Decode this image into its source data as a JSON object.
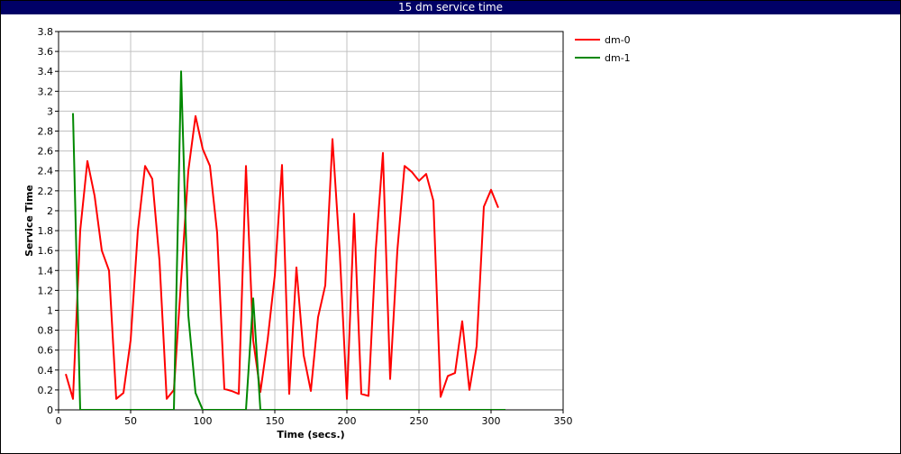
{
  "title": "15 dm service time",
  "colors": {
    "title_bar": "#000066",
    "title_text": "#ffffff",
    "grid": "#c0c0c0",
    "axis": "#000000"
  },
  "chart_data": {
    "type": "line",
    "title": "15 dm service time",
    "xlabel": "Time (secs.)",
    "ylabel": "Service Time",
    "xlim": [
      0,
      350
    ],
    "ylim": [
      0,
      3.8
    ],
    "xticks": [
      0,
      50,
      100,
      150,
      200,
      250,
      300,
      350
    ],
    "yticks": [
      0,
      0.2,
      0.4,
      0.6,
      0.8,
      1,
      1.2,
      1.4,
      1.6,
      1.8,
      2,
      2.2,
      2.4,
      2.6,
      2.8,
      3,
      3.2,
      3.4,
      3.6,
      3.8
    ],
    "grid": true,
    "legend_position": "right",
    "series": [
      {
        "name": "dm-0",
        "color": "#ff0000",
        "x": [
          5,
          10,
          15,
          20,
          25,
          30,
          35,
          40,
          45,
          50,
          55,
          60,
          65,
          70,
          75,
          80,
          85,
          90,
          95,
          100,
          105,
          110,
          115,
          120,
          125,
          130,
          135,
          140,
          145,
          150,
          155,
          160,
          165,
          170,
          175,
          180,
          185,
          190,
          195,
          200,
          205,
          210,
          215,
          220,
          225,
          230,
          235,
          240,
          245,
          250,
          255,
          260,
          265,
          270,
          275,
          280,
          285,
          290,
          295,
          300,
          305
        ],
        "y": [
          0.36,
          0.11,
          1.8,
          2.5,
          2.15,
          1.6,
          1.4,
          0.11,
          0.17,
          0.7,
          1.8,
          2.45,
          2.32,
          1.5,
          0.11,
          0.2,
          1.3,
          2.4,
          2.95,
          2.62,
          2.45,
          1.78,
          0.21,
          0.19,
          0.16,
          2.45,
          0.7,
          0.18,
          0.7,
          1.35,
          2.46,
          0.16,
          1.43,
          0.55,
          0.19,
          0.93,
          1.25,
          2.72,
          1.6,
          0.11,
          1.97,
          0.16,
          0.14,
          1.6,
          2.58,
          0.31,
          1.6,
          2.45,
          2.39,
          2.3,
          2.37,
          2.1,
          0.13,
          0.34,
          0.37,
          0.89,
          0.2,
          0.64,
          2.04,
          2.21,
          2.03
        ]
      },
      {
        "name": "dm-1",
        "color": "#008800",
        "x": [
          10,
          15,
          20,
          30,
          40,
          50,
          60,
          70,
          80,
          85,
          90,
          95,
          100,
          110,
          120,
          130,
          135,
          140,
          150,
          160,
          170,
          180,
          190,
          200,
          210,
          220,
          230,
          240,
          250,
          260,
          270,
          280,
          290,
          300,
          310
        ],
        "y": [
          2.98,
          0,
          0,
          0,
          0,
          0,
          0,
          0,
          0,
          3.4,
          0.95,
          0.17,
          0,
          0,
          0,
          0,
          1.12,
          0,
          0,
          0,
          0,
          0,
          0,
          0,
          0,
          0,
          0,
          0,
          0,
          0,
          0,
          0,
          0,
          0,
          0
        ]
      }
    ]
  }
}
